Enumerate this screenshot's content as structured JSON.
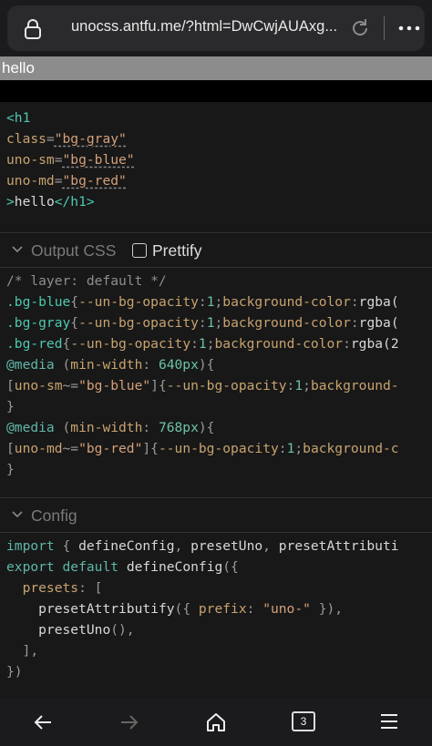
{
  "browser": {
    "url": "unocss.antfu.me/?html=DwCwjAUAxg...",
    "tab_count": "3"
  },
  "preview": {
    "text": "hello"
  },
  "html_code": {
    "lines": [
      [
        {
          "t": "<h1",
          "c": "tag"
        }
      ],
      [
        {
          "t": "class",
          "c": "attr"
        },
        {
          "t": "=",
          "c": "punc"
        },
        {
          "t": "\"bg-gray\"",
          "c": "str u"
        }
      ],
      [
        {
          "t": "uno-sm",
          "c": "attr"
        },
        {
          "t": "=",
          "c": "punc"
        },
        {
          "t": "\"bg-blue\"",
          "c": "str u"
        }
      ],
      [
        {
          "t": "uno-md",
          "c": "attr"
        },
        {
          "t": "=",
          "c": "punc"
        },
        {
          "t": "\"bg-red\"",
          "c": "str u"
        }
      ],
      [
        {
          "t": ">",
          "c": "tag"
        },
        {
          "t": "hello",
          "c": "txt"
        },
        {
          "t": "</h1>",
          "c": "tag"
        }
      ]
    ]
  },
  "output_css": {
    "header": "Output CSS",
    "prettify_label": "Prettify",
    "lines": [
      [
        {
          "t": "/* layer: default */",
          "c": "cmt"
        }
      ],
      [
        {
          "t": ".bg-blue",
          "c": "sel"
        },
        {
          "t": "{",
          "c": "punc"
        },
        {
          "t": "--un-bg-opacity",
          "c": "prop"
        },
        {
          "t": ":",
          "c": "punc"
        },
        {
          "t": "1",
          "c": "num"
        },
        {
          "t": ";",
          "c": "punc"
        },
        {
          "t": "background-color",
          "c": "prop"
        },
        {
          "t": ":",
          "c": "punc"
        },
        {
          "t": "rgba(",
          "c": "txt"
        }
      ],
      [
        {
          "t": ".bg-gray",
          "c": "sel"
        },
        {
          "t": "{",
          "c": "punc"
        },
        {
          "t": "--un-bg-opacity",
          "c": "prop"
        },
        {
          "t": ":",
          "c": "punc"
        },
        {
          "t": "1",
          "c": "num"
        },
        {
          "t": ";",
          "c": "punc"
        },
        {
          "t": "background-color",
          "c": "prop"
        },
        {
          "t": ":",
          "c": "punc"
        },
        {
          "t": "rgba(",
          "c": "txt"
        }
      ],
      [
        {
          "t": ".bg-red",
          "c": "sel"
        },
        {
          "t": "{",
          "c": "punc"
        },
        {
          "t": "--un-bg-opacity",
          "c": "prop"
        },
        {
          "t": ":",
          "c": "punc"
        },
        {
          "t": "1",
          "c": "num"
        },
        {
          "t": ";",
          "c": "punc"
        },
        {
          "t": "background-color",
          "c": "prop"
        },
        {
          "t": ":",
          "c": "punc"
        },
        {
          "t": "rgba(2",
          "c": "txt"
        }
      ],
      [
        {
          "t": "@media",
          "c": "kw"
        },
        {
          "t": " (",
          "c": "punc"
        },
        {
          "t": "min-width",
          "c": "prop"
        },
        {
          "t": ": ",
          "c": "punc"
        },
        {
          "t": "640px",
          "c": "num"
        },
        {
          "t": "){",
          "c": "punc"
        }
      ],
      [
        {
          "t": "[",
          "c": "punc"
        },
        {
          "t": "uno-sm",
          "c": "prop"
        },
        {
          "t": "~=",
          "c": "punc"
        },
        {
          "t": "\"bg-blue\"",
          "c": "str"
        },
        {
          "t": "]{",
          "c": "punc"
        },
        {
          "t": "--un-bg-opacity",
          "c": "prop"
        },
        {
          "t": ":",
          "c": "punc"
        },
        {
          "t": "1",
          "c": "num"
        },
        {
          "t": ";",
          "c": "punc"
        },
        {
          "t": "background-",
          "c": "prop"
        }
      ],
      [
        {
          "t": "}",
          "c": "punc"
        }
      ],
      [
        {
          "t": "@media",
          "c": "kw"
        },
        {
          "t": " (",
          "c": "punc"
        },
        {
          "t": "min-width",
          "c": "prop"
        },
        {
          "t": ": ",
          "c": "punc"
        },
        {
          "t": "768px",
          "c": "num"
        },
        {
          "t": "){",
          "c": "punc"
        }
      ],
      [
        {
          "t": "[",
          "c": "punc"
        },
        {
          "t": "uno-md",
          "c": "prop"
        },
        {
          "t": "~=",
          "c": "punc"
        },
        {
          "t": "\"bg-red\"",
          "c": "str"
        },
        {
          "t": "]{",
          "c": "punc"
        },
        {
          "t": "--un-bg-opacity",
          "c": "prop"
        },
        {
          "t": ":",
          "c": "punc"
        },
        {
          "t": "1",
          "c": "num"
        },
        {
          "t": ";",
          "c": "punc"
        },
        {
          "t": "background-c",
          "c": "prop"
        }
      ],
      [
        {
          "t": "}",
          "c": "punc"
        }
      ]
    ]
  },
  "config": {
    "header": "Config",
    "lines": [
      [
        {
          "t": "import",
          "c": "kw"
        },
        {
          "t": " { ",
          "c": "punc"
        },
        {
          "t": "defineConfig",
          "c": "fn"
        },
        {
          "t": ", ",
          "c": "punc"
        },
        {
          "t": "presetUno",
          "c": "fn"
        },
        {
          "t": ", ",
          "c": "punc"
        },
        {
          "t": "presetAttributi",
          "c": "fn"
        }
      ],
      [
        {
          "t": "export",
          "c": "kw"
        },
        {
          "t": " ",
          "c": "punc"
        },
        {
          "t": "default",
          "c": "kw"
        },
        {
          "t": " ",
          "c": "punc"
        },
        {
          "t": "defineConfig",
          "c": "fn"
        },
        {
          "t": "({",
          "c": "punc"
        }
      ],
      [
        {
          "t": "  ",
          "c": "punc"
        },
        {
          "t": "presets",
          "c": "attr"
        },
        {
          "t": ": [",
          "c": "punc"
        }
      ],
      [
        {
          "t": "    ",
          "c": "punc"
        },
        {
          "t": "presetAttributify",
          "c": "fn"
        },
        {
          "t": "({ ",
          "c": "punc"
        },
        {
          "t": "prefix",
          "c": "attr"
        },
        {
          "t": ": ",
          "c": "punc"
        },
        {
          "t": "\"uno-\"",
          "c": "str"
        },
        {
          "t": " }),",
          "c": "punc"
        }
      ],
      [
        {
          "t": "    ",
          "c": "punc"
        },
        {
          "t": "presetUno",
          "c": "fn"
        },
        {
          "t": "(),",
          "c": "punc"
        }
      ],
      [
        {
          "t": "  ],",
          "c": "punc"
        }
      ],
      [
        {
          "t": "})",
          "c": "punc"
        }
      ]
    ]
  },
  "icons": {
    "lock": "lock-icon",
    "reload": "reload-icon",
    "more": "more-icon",
    "back": "back-arrow-icon",
    "forward": "forward-arrow-icon",
    "home": "home-icon",
    "tabs": "tabs-icon",
    "menu": "menu-icon",
    "chevron": "chevron-down-icon"
  }
}
